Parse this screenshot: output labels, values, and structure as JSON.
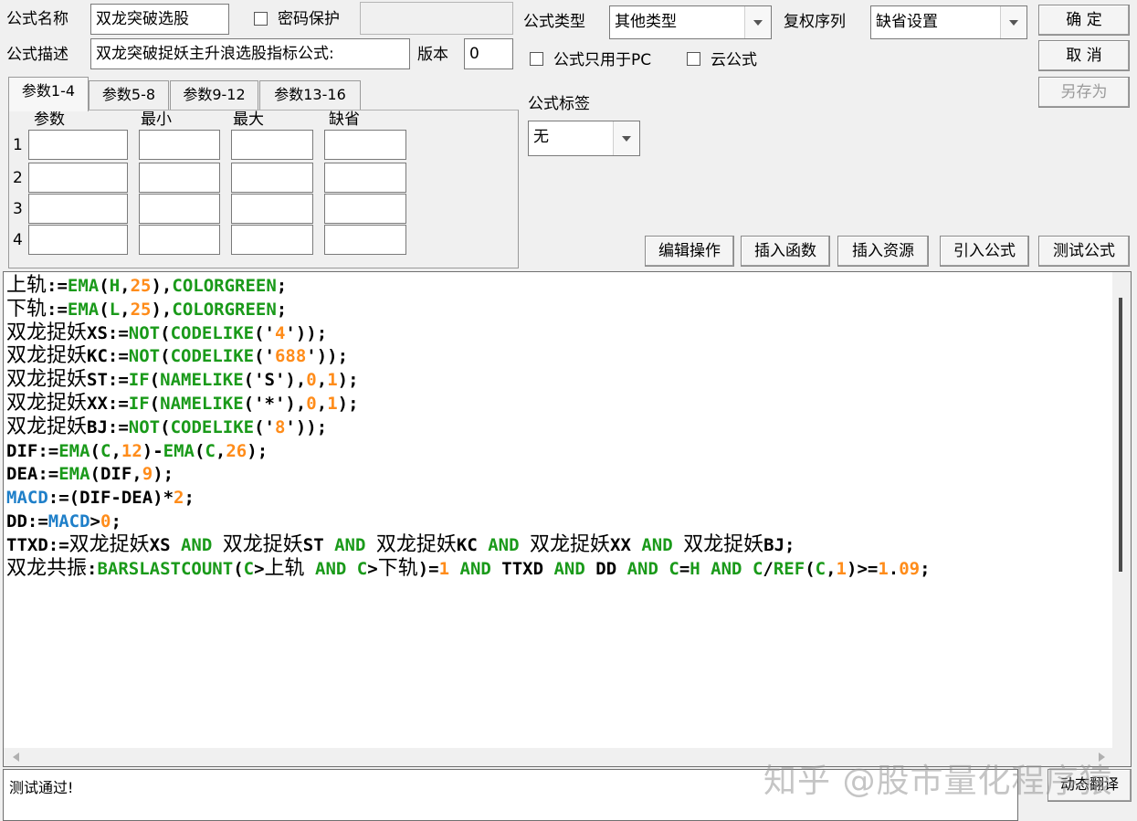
{
  "form": {
    "name_label": "公式名称",
    "name_value": "双龙突破选股",
    "password_label": "密码保护",
    "desc_label": "公式描述",
    "desc_value": "双龙突破捉妖主升浪选股指标公式:",
    "version_label": "版本",
    "version_value": "0",
    "type_label": "公式类型",
    "type_value": "其他类型",
    "fuquan_label": "复权序列",
    "fuquan_value": "缺省设置",
    "pc_only_label": "公式只用于PC",
    "cloud_label": "云公式",
    "tag_label": "公式标签",
    "tag_value": "无"
  },
  "buttons": {
    "ok": "确 定",
    "cancel": "取 消",
    "save_as": "另存为",
    "edit_ops": "编辑操作",
    "insert_func": "插入函数",
    "insert_res": "插入资源",
    "import_formula": "引入公式",
    "test_formula": "测试公式",
    "dynamic_translate": "动态翻译"
  },
  "params": {
    "tabs": [
      "参数1-4",
      "参数5-8",
      "参数9-12",
      "参数13-16"
    ],
    "headers": [
      "参数",
      "最小",
      "最大",
      "缺省"
    ],
    "rows": [
      "1",
      "2",
      "3",
      "4"
    ]
  },
  "code_lines": [
    [
      [
        "cn",
        "上轨"
      ],
      [
        "t",
        ":="
      ],
      [
        "g",
        "EMA"
      ],
      [
        "t",
        "("
      ],
      [
        "g",
        "H"
      ],
      [
        "t",
        ","
      ],
      [
        "o",
        "25"
      ],
      [
        "t",
        "),"
      ],
      [
        "g",
        "COLORGREEN"
      ],
      [
        "t",
        ";"
      ]
    ],
    [
      [
        "cn",
        "下轨"
      ],
      [
        "t",
        ":="
      ],
      [
        "g",
        "EMA"
      ],
      [
        "t",
        "("
      ],
      [
        "g",
        "L"
      ],
      [
        "t",
        ","
      ],
      [
        "o",
        "25"
      ],
      [
        "t",
        "),"
      ],
      [
        "g",
        "COLORGREEN"
      ],
      [
        "t",
        ";"
      ]
    ],
    [
      [
        "cn",
        "双龙捉妖"
      ],
      [
        "t",
        "XS:="
      ],
      [
        "g",
        "NOT"
      ],
      [
        "t",
        "("
      ],
      [
        "g",
        "CODELIKE"
      ],
      [
        "t",
        "('"
      ],
      [
        "o",
        "4"
      ],
      [
        "t",
        "'));"
      ]
    ],
    [
      [
        "cn",
        "双龙捉妖"
      ],
      [
        "t",
        "KC:="
      ],
      [
        "g",
        "NOT"
      ],
      [
        "t",
        "("
      ],
      [
        "g",
        "CODELIKE"
      ],
      [
        "t",
        "('"
      ],
      [
        "o",
        "688"
      ],
      [
        "t",
        "'));"
      ]
    ],
    [
      [
        "cn",
        "双龙捉妖"
      ],
      [
        "t",
        "ST:="
      ],
      [
        "g",
        "IF"
      ],
      [
        "t",
        "("
      ],
      [
        "g",
        "NAMELIKE"
      ],
      [
        "t",
        "('S'),"
      ],
      [
        "o",
        "0"
      ],
      [
        "t",
        ","
      ],
      [
        "o",
        "1"
      ],
      [
        "t",
        ");"
      ]
    ],
    [
      [
        "cn",
        "双龙捉妖"
      ],
      [
        "t",
        "XX:="
      ],
      [
        "g",
        "IF"
      ],
      [
        "t",
        "("
      ],
      [
        "g",
        "NAMELIKE"
      ],
      [
        "t",
        "('*'),"
      ],
      [
        "o",
        "0"
      ],
      [
        "t",
        ","
      ],
      [
        "o",
        "1"
      ],
      [
        "t",
        ");"
      ]
    ],
    [
      [
        "cn",
        "双龙捉妖"
      ],
      [
        "t",
        "BJ:="
      ],
      [
        "g",
        "NOT"
      ],
      [
        "t",
        "("
      ],
      [
        "g",
        "CODELIKE"
      ],
      [
        "t",
        "('"
      ],
      [
        "o",
        "8"
      ],
      [
        "t",
        "'));"
      ]
    ],
    [
      [
        "t",
        "DIF:="
      ],
      [
        "g",
        "EMA"
      ],
      [
        "t",
        "("
      ],
      [
        "g",
        "C"
      ],
      [
        "t",
        ","
      ],
      [
        "o",
        "12"
      ],
      [
        "t",
        ")-"
      ],
      [
        "g",
        "EMA"
      ],
      [
        "t",
        "("
      ],
      [
        "g",
        "C"
      ],
      [
        "t",
        ","
      ],
      [
        "o",
        "26"
      ],
      [
        "t",
        ");"
      ]
    ],
    [
      [
        "t",
        "DEA:="
      ],
      [
        "g",
        "EMA"
      ],
      [
        "t",
        "(DIF,"
      ],
      [
        "o",
        "9"
      ],
      [
        "t",
        ");"
      ]
    ],
    [
      [
        "b",
        "MACD"
      ],
      [
        "t",
        ":=(DIF-DEA)*"
      ],
      [
        "o",
        "2"
      ],
      [
        "t",
        ";"
      ]
    ],
    [
      [
        "t",
        "DD:="
      ],
      [
        "b",
        "MACD"
      ],
      [
        "t",
        ">"
      ],
      [
        "o",
        "0"
      ],
      [
        "t",
        ";"
      ]
    ],
    [
      [
        "t",
        "TTXD:="
      ],
      [
        "cn",
        "双龙捉妖"
      ],
      [
        "t",
        "XS "
      ],
      [
        "g",
        "AND"
      ],
      [
        "t",
        " "
      ],
      [
        "cn",
        "双龙捉妖"
      ],
      [
        "t",
        "ST "
      ],
      [
        "g",
        "AND"
      ],
      [
        "t",
        " "
      ],
      [
        "cn",
        "双龙捉妖"
      ],
      [
        "t",
        "KC "
      ],
      [
        "g",
        "AND"
      ],
      [
        "t",
        " "
      ],
      [
        "cn",
        "双龙捉妖"
      ],
      [
        "t",
        "XX "
      ],
      [
        "g",
        "AND"
      ],
      [
        "t",
        " "
      ],
      [
        "cn",
        "双龙捉妖"
      ],
      [
        "t",
        "BJ;"
      ]
    ],
    [
      [
        "cn",
        "双龙共振"
      ],
      [
        "t",
        ":"
      ],
      [
        "g",
        "BARSLASTCOUNT"
      ],
      [
        "t",
        "("
      ],
      [
        "g",
        "C"
      ],
      [
        "t",
        ">"
      ],
      [
        "cn",
        "上轨"
      ],
      [
        "t",
        " "
      ],
      [
        "g",
        "AND"
      ],
      [
        "t",
        " "
      ],
      [
        "g",
        "C"
      ],
      [
        "t",
        ">"
      ],
      [
        "cn",
        "下轨"
      ],
      [
        "t",
        ")="
      ],
      [
        "o",
        "1"
      ],
      [
        "t",
        " "
      ],
      [
        "g",
        "AND"
      ],
      [
        "t",
        " TTXD "
      ],
      [
        "g",
        "AND"
      ],
      [
        "t",
        " DD "
      ],
      [
        "g",
        "AND"
      ],
      [
        "t",
        " "
      ],
      [
        "g",
        "C"
      ],
      [
        "t",
        "="
      ],
      [
        "g",
        "H"
      ],
      [
        "t",
        " "
      ],
      [
        "g",
        "AND"
      ],
      [
        "t",
        " "
      ],
      [
        "g",
        "C"
      ],
      [
        "t",
        "/"
      ],
      [
        "g",
        "REF"
      ],
      [
        "t",
        "("
      ],
      [
        "g",
        "C"
      ],
      [
        "t",
        ","
      ],
      [
        "o",
        "1"
      ],
      [
        "t",
        ")>="
      ],
      [
        "o",
        "1"
      ],
      [
        "t",
        "."
      ],
      [
        "o",
        "09"
      ],
      [
        "t",
        ";"
      ]
    ]
  ],
  "status_text": "测试通过!",
  "watermark": "知乎 @股市量化程序猿"
}
